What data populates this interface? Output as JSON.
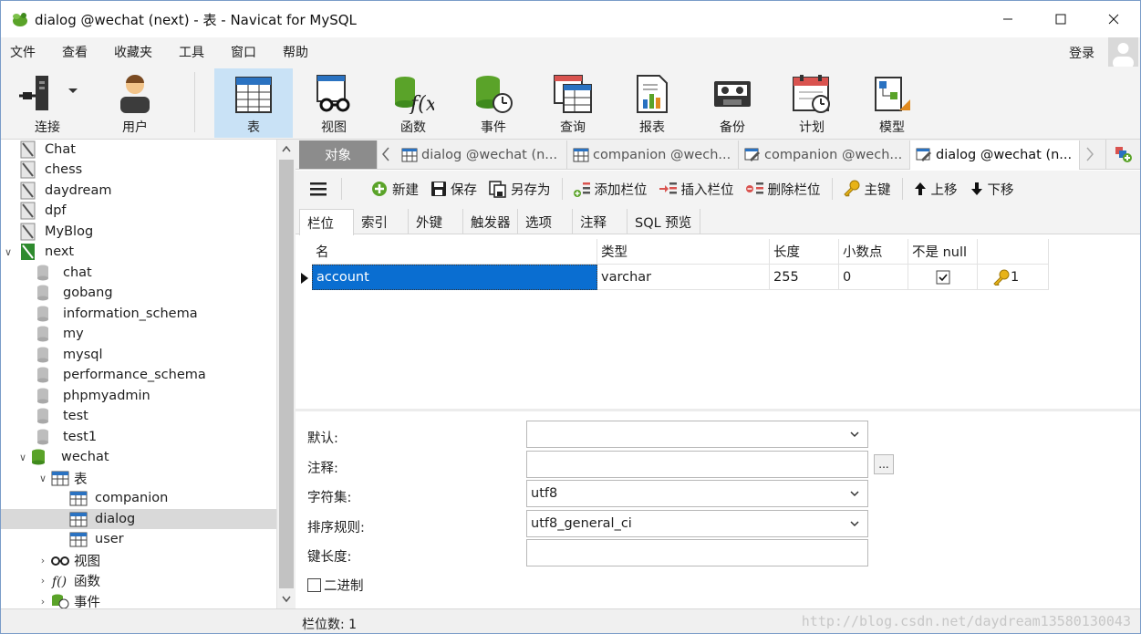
{
  "window": {
    "title": "dialog @wechat (next) - 表 - Navicat for MySQL"
  },
  "menu": [
    "文件",
    "查看",
    "收藏夹",
    "工具",
    "窗口",
    "帮助"
  ],
  "login_label": "登录",
  "toolbar": [
    {
      "label": "连接",
      "icon": "plug-icon"
    },
    {
      "label": "用户",
      "icon": "user-icon"
    },
    {
      "label": "表",
      "icon": "table-icon",
      "active": true
    },
    {
      "label": "视图",
      "icon": "glasses-icon"
    },
    {
      "label": "函数",
      "icon": "function-icon"
    },
    {
      "label": "事件",
      "icon": "event-icon"
    },
    {
      "label": "查询",
      "icon": "query-icon"
    },
    {
      "label": "报表",
      "icon": "report-icon"
    },
    {
      "label": "备份",
      "icon": "backup-icon"
    },
    {
      "label": "计划",
      "icon": "calendar-icon"
    },
    {
      "label": "模型",
      "icon": "model-icon"
    }
  ],
  "tree": [
    {
      "label": "Chat",
      "type": "connection"
    },
    {
      "label": "chess",
      "type": "connection"
    },
    {
      "label": "daydream",
      "type": "connection"
    },
    {
      "label": "dpf",
      "type": "connection"
    },
    {
      "label": "MyBlog",
      "type": "connection"
    },
    {
      "label": "next",
      "type": "connection-open"
    },
    {
      "label": "chat",
      "type": "db"
    },
    {
      "label": "gobang",
      "type": "db"
    },
    {
      "label": "information_schema",
      "type": "db"
    },
    {
      "label": "my",
      "type": "db"
    },
    {
      "label": "mysql",
      "type": "db"
    },
    {
      "label": "performance_schema",
      "type": "db"
    },
    {
      "label": "phpmyadmin",
      "type": "db"
    },
    {
      "label": "test",
      "type": "db"
    },
    {
      "label": "test1",
      "type": "db"
    },
    {
      "label": "wechat",
      "type": "db-open"
    },
    {
      "label": "表",
      "type": "tables"
    },
    {
      "label": "companion",
      "type": "table"
    },
    {
      "label": "dialog",
      "type": "table",
      "selected": true
    },
    {
      "label": "user",
      "type": "table"
    },
    {
      "label": "视图",
      "type": "views"
    },
    {
      "label": "函数",
      "type": "functions"
    },
    {
      "label": "事件",
      "type": "events"
    }
  ],
  "tabs": {
    "objects": "对象",
    "open": [
      {
        "label": "dialog @wechat (n...",
        "icon": "table-icon"
      },
      {
        "label": "companion @wech...",
        "icon": "table-icon"
      },
      {
        "label": "companion @wech...",
        "icon": "table-edit-icon"
      },
      {
        "label": "dialog @wechat (n...",
        "icon": "table-edit-icon",
        "active": true
      }
    ]
  },
  "editor_toolbar": {
    "new": "新建",
    "save": "保存",
    "save_as": "另存为",
    "add_field": "添加栏位",
    "insert_field": "插入栏位",
    "delete_field": "删除栏位",
    "primary_key": "主键",
    "move_up": "上移",
    "move_down": "下移"
  },
  "subtabs": [
    "栏位",
    "索引",
    "外键",
    "触发器",
    "选项",
    "注释",
    "SQL 预览"
  ],
  "grid": {
    "headers": [
      "名",
      "类型",
      "长度",
      "小数点",
      "不是 null",
      ""
    ],
    "rows": [
      {
        "name": "account",
        "type": "varchar",
        "length": "255",
        "decimals": "0",
        "not_null": true,
        "key": "1"
      }
    ]
  },
  "props": {
    "default_label": "默认:",
    "default_value": "",
    "comment_label": "注释:",
    "comment_value": "",
    "charset_label": "字符集:",
    "charset_value": "utf8",
    "collation_label": "排序规则:",
    "collation_value": "utf8_general_ci",
    "keylen_label": "键长度:",
    "keylen_value": "",
    "binary_label": "二进制",
    "ellipsis": "..."
  },
  "status": {
    "fields": "栏位数: 1"
  },
  "watermark": "http://blog.csdn.net/daydream13580130043"
}
